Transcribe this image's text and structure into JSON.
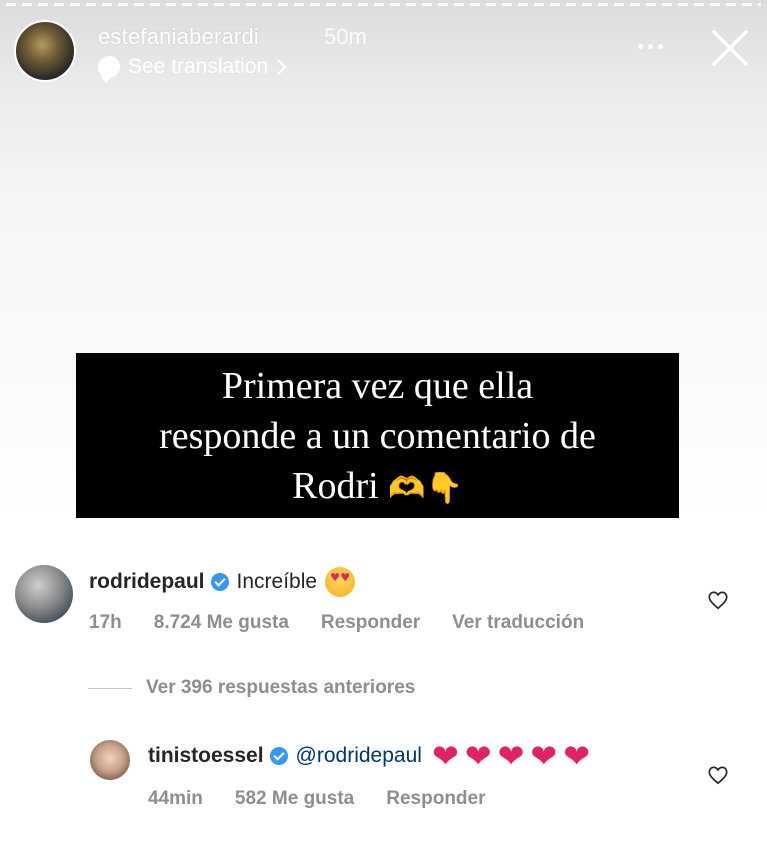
{
  "story": {
    "username": "estefaniaberardi",
    "time": "50m",
    "see_translation": "See translation",
    "caption_line1": "Primera vez que ella",
    "caption_line2": "responde a un comentario de",
    "caption_line3": "Rodri",
    "caption_emoji": "🫶👇"
  },
  "comments": [
    {
      "username": "rodridepaul",
      "text": "Increíble",
      "time": "17h",
      "likes": "8.724 Me gusta",
      "reply_label": "Responder",
      "translate_label": "Ver traducción"
    },
    {
      "username": "tinistoessel",
      "mention": "@rodridepaul",
      "hearts": [
        "❤",
        "❤",
        "❤",
        "❤",
        "❤"
      ],
      "time": "44min",
      "likes": "582 Me gusta",
      "reply_label": "Responder"
    }
  ],
  "view_replies": "Ver 396 respuestas anteriores",
  "colors": {
    "verified": "#3897f0",
    "heart_red": "#e0245e",
    "meta_gray": "#8e8e8e",
    "caption_bg": "#000000"
  },
  "icons": [
    "translate-icon",
    "more-icon",
    "close-icon",
    "verified-icon",
    "heart-outline-icon",
    "heart-eyes-emoji",
    "red-heart-emoji"
  ]
}
